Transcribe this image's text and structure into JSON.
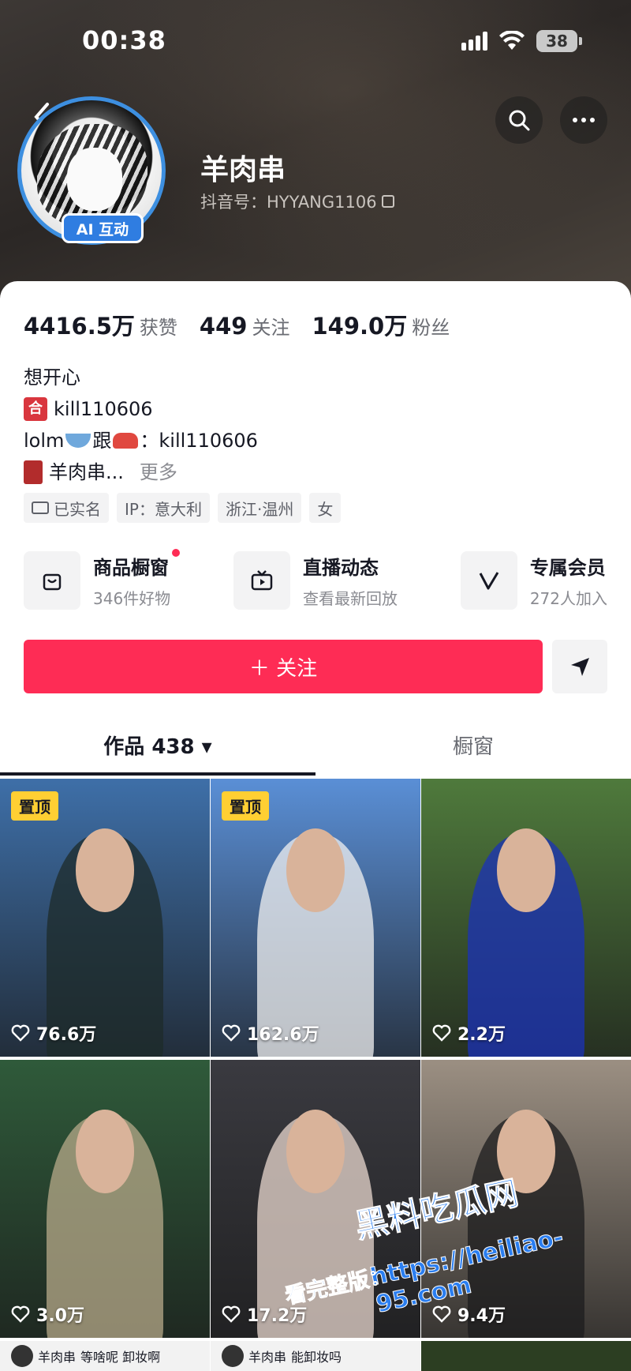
{
  "status_bar": {
    "time": "00:38",
    "battery": "38"
  },
  "profile": {
    "name": "羊肉串",
    "douyin_id": "抖音号：HYYANG1106",
    "ai_badge": "AI 互动"
  },
  "stats": [
    {
      "value": "4416.5万",
      "label": "获赞"
    },
    {
      "value": "449",
      "label": "关注"
    },
    {
      "value": "149.0万",
      "label": "粉丝"
    }
  ],
  "bio": {
    "line1": "想开心",
    "line2_icon": "合",
    "line2": "kill110606",
    "line3_prefix": "lolm",
    "line3_mid": "跟",
    "line3_suffix": "：kill110606",
    "line4": "羊肉串...",
    "more": "更多"
  },
  "tags": [
    "已实名",
    "IP：意大利",
    "浙江·温州",
    "女"
  ],
  "features": [
    {
      "title": "商品橱窗",
      "subtitle": "346件好物",
      "icon": "bag-icon"
    },
    {
      "title": "直播动态",
      "subtitle": "查看最新回放",
      "icon": "tv-icon"
    },
    {
      "title": "专属会员",
      "subtitle": "272人加入",
      "icon": "v-icon"
    }
  ],
  "follow_button": "＋ 关注",
  "tabs": {
    "works": "作品 438 ▾",
    "showcase": "橱窗"
  },
  "pinned_label": "置顶",
  "videos": [
    {
      "likes": "76.6万",
      "pinned": true,
      "bg": "#3e6fa8",
      "fg": "#1e2b2a"
    },
    {
      "likes": "162.6万",
      "pinned": true,
      "bg": "#5a8fd6",
      "fg": "#f1f1f1"
    },
    {
      "likes": "2.2万",
      "pinned": false,
      "bg": "#4f7a3c",
      "fg": "#1b32b8"
    },
    {
      "likes": "3.0万",
      "pinned": false,
      "bg": "#2f5a3a",
      "fg": "#b7a98a"
    },
    {
      "likes": "17.2万",
      "pinned": false,
      "bg": "#3a3a40",
      "fg": "#e9d8cf"
    },
    {
      "likes": "9.4万",
      "pinned": false,
      "bg": "#9b8f82",
      "fg": "#1c1c1e"
    }
  ],
  "partial_row": [
    {
      "author": "羊肉串",
      "caption": "等啥呢 卸妆啊"
    },
    {
      "author": "羊肉串",
      "caption": "能卸妆吗"
    },
    {
      "author": "",
      "caption": ""
    }
  ],
  "watermark": {
    "title": "黑料吃瓜网",
    "url": "https://heiliao-95.com",
    "sub": "看完整版："
  }
}
